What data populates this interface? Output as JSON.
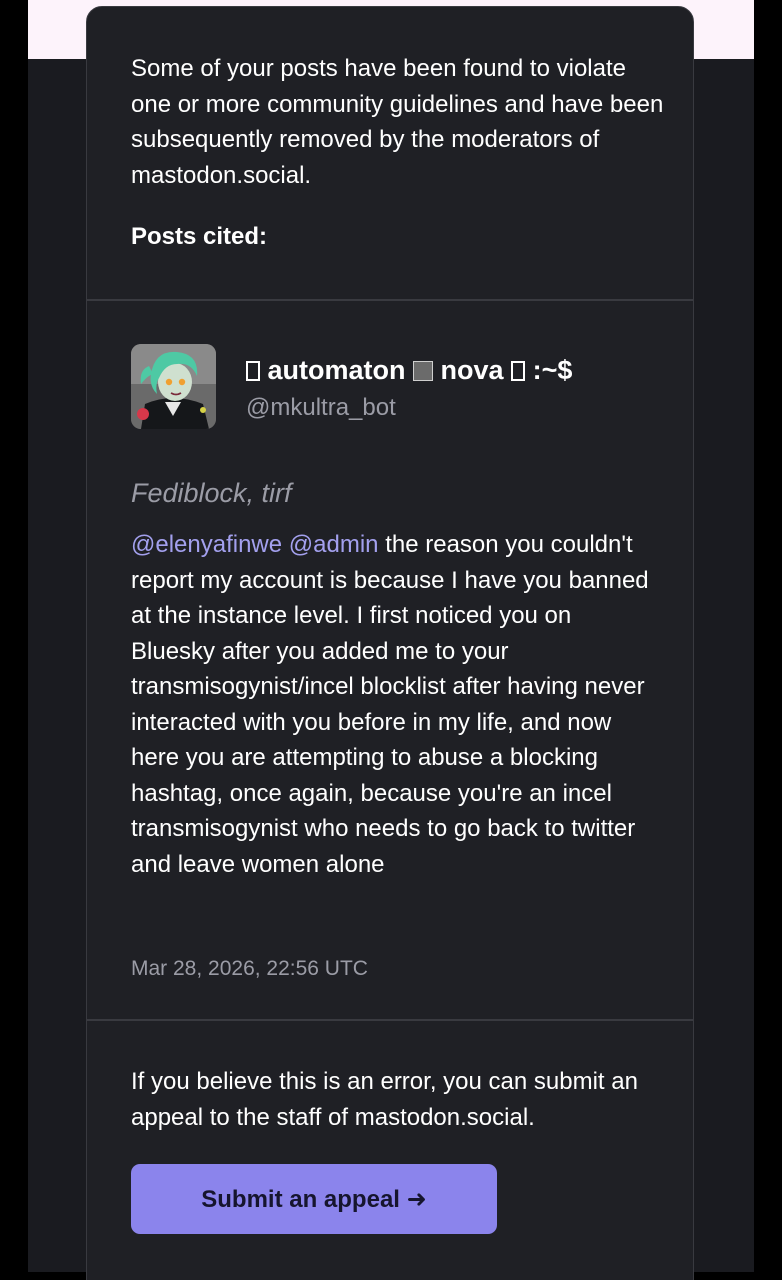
{
  "notice": {
    "intro": "Some of your posts have been found to violate one or more community guidelines and have been subsequently removed by the moderators of mastodon.social.",
    "posts_cited_label": "Posts cited:"
  },
  "post": {
    "display_name_part1": "automaton",
    "display_name_part2": "nova",
    "display_name_part3": ":~$",
    "handle": "@mkultra_bot",
    "content_warning": "Fediblock, tirf",
    "mention_1": "@elenyafinwe",
    "mention_2": "@admin",
    "body": " the reason you couldn't report my account is because I have you banned at the instance level. I first noticed you on Bluesky after you added me to your transmisogynist/incel blocklist after having never interacted with you before in my life, and now here you are attempting to abuse a blocking hashtag, once again, because you're an incel transmisogynist who needs to go back to twitter and leave women alone",
    "timestamp": "Mar 28, 2026, 22:56 UTC",
    "avatar_icon": "avatar-illustration"
  },
  "appeal": {
    "text": "If you believe this is an error, you can submit an appeal to the staff of mastodon.social.",
    "button_label": "Submit an appeal ➜"
  },
  "colors": {
    "page_background": "#1a1b20",
    "card_background": "#1f2025",
    "card_border": "#393a40",
    "header_strip": "#fdf3fb",
    "mention": "#a3a0ee",
    "muted_text": "#9b9ca6",
    "button_background": "#8b84ec",
    "button_text": "#16152e"
  }
}
